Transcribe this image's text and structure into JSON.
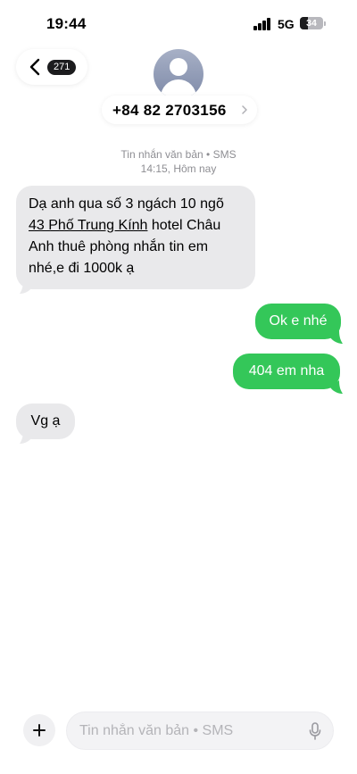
{
  "status_bar": {
    "time": "19:44",
    "network": "5G",
    "battery": "34",
    "battery_level": 0.34
  },
  "header": {
    "back_count": "271",
    "contact": "+84 82 2703156"
  },
  "meta": {
    "type": "Tin nhắn văn bản • SMS",
    "time": "14:15, Hôm nay"
  },
  "messages": [
    {
      "direction": "incoming",
      "lines": [
        "Dạ anh qua số 3 ngách 10 ngõ",
        "43 Phố Trung Kính",
        " hotel Châu",
        "Anh thuê phòng nhắn tin em",
        "nhé,e đi 1000k ạ"
      ]
    },
    {
      "direction": "outgoing",
      "text": "Ok e nhé"
    },
    {
      "direction": "outgoing",
      "text": "404 em nha"
    },
    {
      "direction": "incoming",
      "text": "Vg ạ"
    }
  ],
  "composer": {
    "placeholder": "Tin nhắn văn bản • SMS"
  },
  "colors": {
    "incoming_bubble": "#e9e9eb",
    "outgoing_bubble": "#34c759",
    "meta_text": "#8e8e93"
  },
  "icons": {
    "back": "chevron-left-icon",
    "contact": "person-avatar-icon",
    "add": "plus-icon",
    "mic": "microphone-icon"
  }
}
